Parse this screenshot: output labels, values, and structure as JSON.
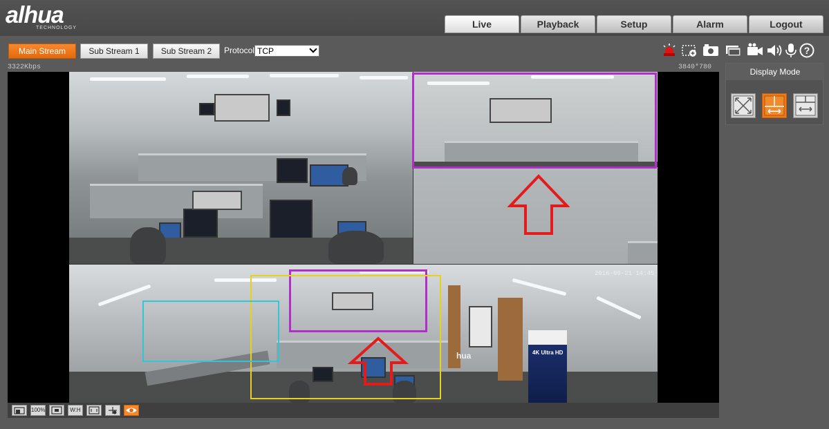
{
  "brand": {
    "logo_main": "alhua",
    "logo_sub": "TECHNOLOGY"
  },
  "nav": {
    "tabs": [
      {
        "label": "Live",
        "active": true
      },
      {
        "label": "Playback",
        "active": false
      },
      {
        "label": "Setup",
        "active": false
      },
      {
        "label": "Alarm",
        "active": false
      },
      {
        "label": "Logout",
        "active": false
      }
    ]
  },
  "toolbar": {
    "streams": [
      {
        "label": "Main Stream",
        "active": true
      },
      {
        "label": "Sub Stream 1",
        "active": false
      },
      {
        "label": "Sub Stream 2",
        "active": false
      }
    ],
    "protocol_label": "Protocol",
    "protocol_value": "TCP",
    "icons": [
      "alarm-light-icon",
      "zoom-region-icon",
      "snapshot-icon",
      "triple-snapshot-icon",
      "record-icon",
      "audio-icon",
      "talk-icon",
      "help-icon"
    ]
  },
  "stream_info": {
    "bitrate": "3322Kbps",
    "resolution": "3840*780"
  },
  "video": {
    "timestamp": "2016-09-21 14:45",
    "overlay_text": "hua",
    "banner_text": "4K Ultra HD",
    "roi_colors": {
      "purple": "#b12ec9",
      "cyan": "#2fc6d8",
      "yellow": "#e8d11d",
      "red": "#e31b1b"
    }
  },
  "bottom_bar": {
    "icons": [
      {
        "name": "original-size-icon",
        "label": ""
      },
      {
        "name": "zoom-100-icon",
        "label": "100%"
      },
      {
        "name": "fit-window-icon",
        "label": ""
      },
      {
        "name": "width-height-icon",
        "label": "W:H"
      },
      {
        "name": "fullscreen-icon",
        "label": ""
      },
      {
        "name": "ptz-icon",
        "label": ""
      },
      {
        "name": "eye-icon",
        "label": "",
        "active": true
      }
    ]
  },
  "display_mode": {
    "title": "Display Mode",
    "selected": "split-view"
  },
  "colors": {
    "accent": "#f07d1f",
    "background": "#5a5a5a"
  }
}
